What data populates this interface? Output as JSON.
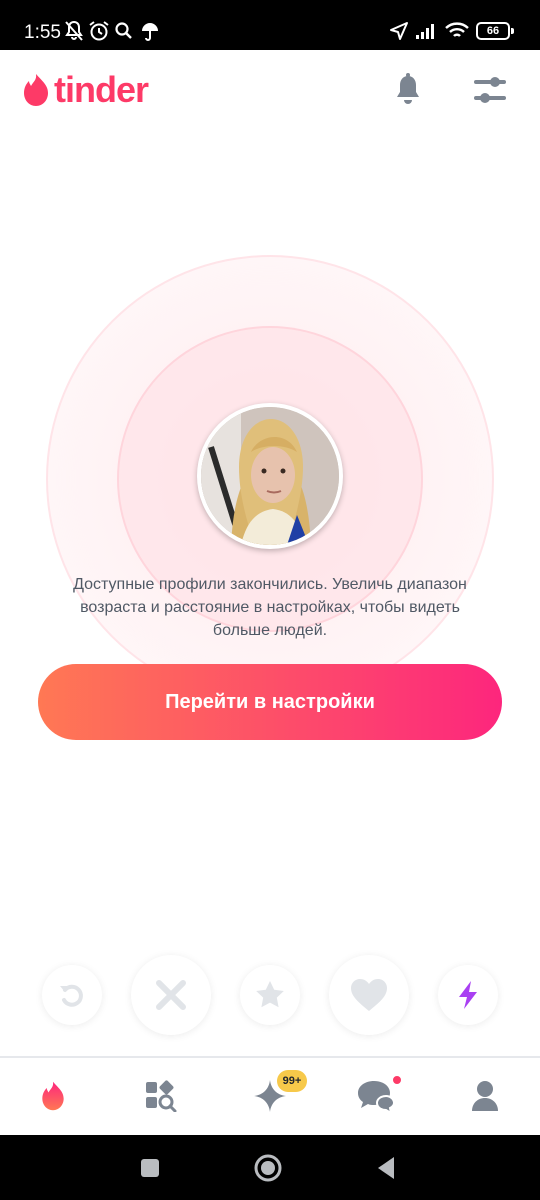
{
  "status_bar": {
    "time": "1:55",
    "battery": "66",
    "icons": [
      "bell-off-icon",
      "alarm-icon",
      "search-icon",
      "umbrella-icon",
      "location-arrow-icon",
      "signal-icon",
      "wifi-icon",
      "battery-icon"
    ]
  },
  "header": {
    "logo_text": "tinder",
    "icons": [
      "flame-icon",
      "bell-icon",
      "filter-sliders-icon"
    ]
  },
  "main": {
    "message": "Доступные профили закончились. Увеличь диапазон возраста и расстояние в настройках, чтобы видеть больше людей.",
    "cta_label": "Перейти в настройки"
  },
  "actions": [
    "rewind-icon",
    "nope-x-icon",
    "super-like-star-icon",
    "like-heart-icon",
    "boost-bolt-icon"
  ],
  "bottom_nav": {
    "items": [
      "tab-home",
      "tab-explore",
      "tab-gold",
      "tab-messages",
      "tab-profile"
    ],
    "gold_badge": "99+"
  },
  "colors": {
    "brand": "#fd3a67",
    "gradient_start": "#ff7854",
    "gradient_end": "#fd267d",
    "icon_gray": "#7c8591",
    "action_gray": "#e1e4e8",
    "boost_purple": "#a93ff2",
    "badge_gold": "#f7c94a"
  }
}
